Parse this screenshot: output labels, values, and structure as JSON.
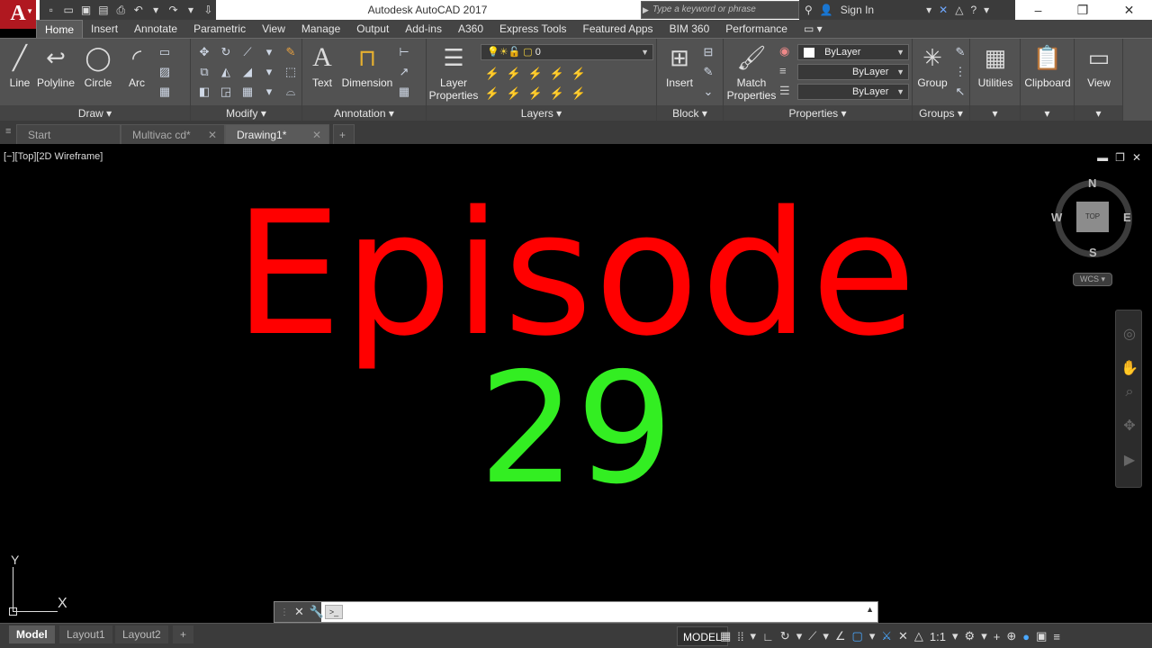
{
  "app": {
    "title": "Autodesk AutoCAD 2017",
    "logo_letter": "A",
    "search_placeholder": "Type a keyword or phrase",
    "sign_in": "Sign In"
  },
  "ribbon_tabs": [
    "Home",
    "Insert",
    "Annotate",
    "Parametric",
    "View",
    "Manage",
    "Output",
    "Add-ins",
    "A360",
    "Express Tools",
    "Featured Apps",
    "BIM 360",
    "Performance"
  ],
  "draw": {
    "line": "Line",
    "polyline": "Polyline",
    "circle": "Circle",
    "arc": "Arc",
    "panel": "Draw"
  },
  "modify": {
    "panel": "Modify"
  },
  "annotation": {
    "text": "Text",
    "dimension": "Dimension",
    "panel": "Annotation"
  },
  "layers": {
    "layer_properties_1": "Layer",
    "layer_properties_2": "Properties",
    "current_layer": "0",
    "panel": "Layers"
  },
  "block": {
    "insert": "Insert",
    "panel": "Block"
  },
  "properties": {
    "match_1": "Match",
    "match_2": "Properties",
    "color": "ByLayer",
    "linetype": "ByLayer",
    "lineweight": "ByLayer",
    "panel": "Properties"
  },
  "groups": {
    "group": "Group",
    "panel": "Groups"
  },
  "utilities": {
    "label": "Utilities"
  },
  "clipboard": {
    "label": "Clipboard"
  },
  "view_panel": {
    "label": "View"
  },
  "doc_tabs": [
    "Start",
    "Multivac cd*",
    "Drawing1*"
  ],
  "viewport": {
    "label": "[−][Top][2D Wireframe]",
    "episode_word": "Episode",
    "episode_number": "29",
    "episode_word_color": "#ff0000",
    "episode_number_color": "#33ee22"
  },
  "viewcube": {
    "top": "TOP",
    "north": "N",
    "south": "S",
    "east": "E",
    "west": "W",
    "wcs": "WCS"
  },
  "ucs": {
    "x": "X",
    "y": "Y"
  },
  "layout_tabs": [
    "Model",
    "Layout1",
    "Layout2"
  ],
  "status": {
    "model": "MODEL",
    "scale": "1:1"
  }
}
